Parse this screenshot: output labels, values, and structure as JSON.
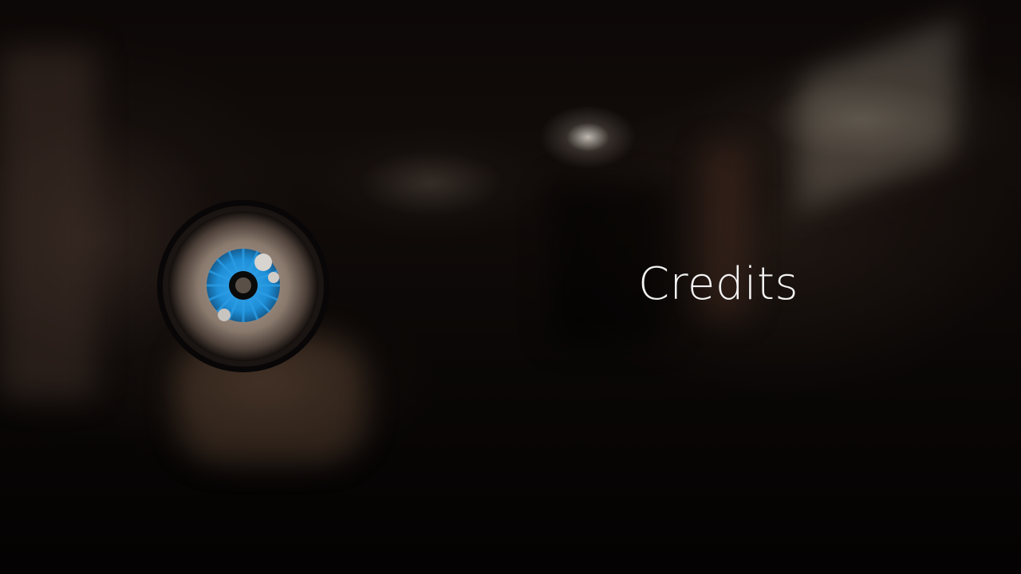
{
  "screen": {
    "title": "Credits"
  },
  "logo": {
    "icon": "eye-icon",
    "iris_color": "#1e8fd8",
    "sclera_color": "#8a7a6e",
    "rim_color": "#0a0808"
  },
  "colors": {
    "title_text": "#f2f2f2",
    "background": "#050303"
  }
}
